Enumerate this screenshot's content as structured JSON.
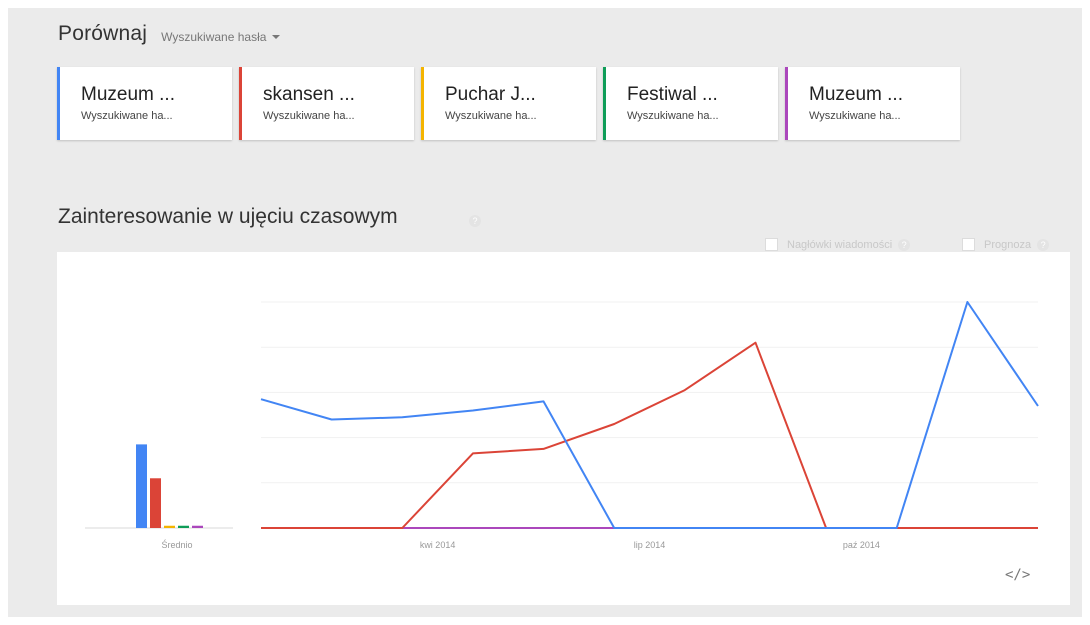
{
  "compare": {
    "title": "Porównaj",
    "type_label": "Wyszukiwane hasła",
    "dropdown_icon": "caret-down-icon"
  },
  "terms": [
    {
      "name": "Muzeum ...",
      "type": "Wyszukiwane ha...",
      "color": "#4285f4"
    },
    {
      "name": "skansen ...",
      "type": "Wyszukiwane ha...",
      "color": "#db4437"
    },
    {
      "name": "Puchar J...",
      "type": "Wyszukiwane ha...",
      "color": "#f4b400"
    },
    {
      "name": "Festiwal ...",
      "type": "Wyszukiwane ha...",
      "color": "#0f9d58"
    },
    {
      "name": "Muzeum ...",
      "type": "Wyszukiwane ha...",
      "color": "#ab47bc"
    }
  ],
  "interest": {
    "title": "Zainteresowanie w ujęciu czasowym",
    "help": "?",
    "options": [
      {
        "label": "Nagłówki wiadomości",
        "help": "?"
      },
      {
        "label": "Prognoza",
        "help": "?"
      }
    ],
    "embed_icon": "code-embed-icon",
    "embed_text": "</>"
  },
  "chart_data": {
    "type": "line",
    "average_label": "Średnio",
    "average_values": [
      37,
      22,
      1,
      1,
      1
    ],
    "x_tick_labels": [
      "kwi 2014",
      "lip 2014",
      "paź 2014"
    ],
    "ylim": [
      0,
      100
    ],
    "grid": true,
    "x_points": 12,
    "series": [
      {
        "color": "#4285f4",
        "values": [
          57,
          48,
          49,
          52,
          56,
          0,
          0,
          0,
          0,
          0,
          100,
          54
        ]
      },
      {
        "color": "#db4437",
        "values": [
          0,
          0,
          0,
          33,
          35,
          46,
          61,
          82,
          0,
          0,
          0,
          0
        ]
      },
      {
        "color": "#f4b400",
        "values": [
          0,
          0,
          0,
          0,
          0,
          0,
          0,
          0,
          0,
          0,
          0,
          0
        ]
      },
      {
        "color": "#0f9d58",
        "values": [
          0,
          0,
          0,
          0,
          0,
          0,
          0,
          0,
          0,
          0,
          0,
          0
        ]
      },
      {
        "color": "#ab47bc",
        "values": [
          0,
          0,
          0,
          0,
          0,
          0,
          0,
          0,
          0,
          0,
          0,
          0
        ]
      }
    ]
  }
}
